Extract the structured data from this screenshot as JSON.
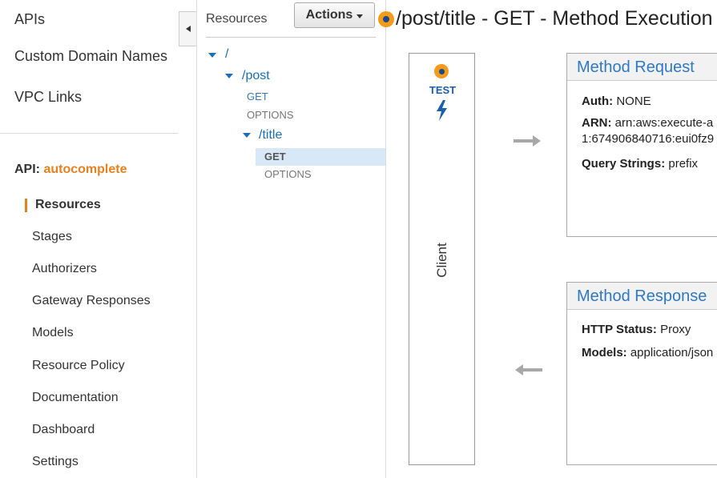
{
  "nav": {
    "top_links": [
      "APIs",
      "Custom Domain Names",
      "VPC Links"
    ],
    "api_prefix": "API:",
    "api_name": "autocomplete",
    "items": [
      {
        "label": "Resources",
        "active": true
      },
      {
        "label": "Stages"
      },
      {
        "label": "Authorizers"
      },
      {
        "label": "Gateway Responses"
      },
      {
        "label": "Models"
      },
      {
        "label": "Resource Policy"
      },
      {
        "label": "Documentation"
      },
      {
        "label": "Dashboard"
      },
      {
        "label": "Settings"
      }
    ]
  },
  "tree": {
    "title": "Resources",
    "actions_label": "Actions",
    "root": "/",
    "post": "/post",
    "post_methods": [
      "GET",
      "OPTIONS"
    ],
    "title_res": "/title",
    "title_methods": [
      "GET",
      "OPTIONS"
    ],
    "selected": "GET"
  },
  "main": {
    "title": "/post/title - GET - Method Execution",
    "client": {
      "test_label": "TEST",
      "label": "Client"
    },
    "method_request": {
      "heading": "Method Request",
      "auth_key": "Auth:",
      "auth_val": "NONE",
      "arn_key": "ARN:",
      "arn_val": "arn:aws:execute-a",
      "arn_val2": "1:674906840716:eui0fz9",
      "qs_key": "Query Strings:",
      "qs_val": "prefix"
    },
    "method_response": {
      "heading": "Method Response",
      "status_key": "HTTP Status:",
      "status_val": "Proxy",
      "models_key": "Models:",
      "models_val": "application/json"
    }
  },
  "colors": {
    "accent_orange": "#e7801f",
    "link_blue": "#1a6fb5",
    "selected_bg": "#d8e8f7"
  },
  "icons": [
    "collapse-left-icon",
    "caret-down-icon",
    "status-dot-icon",
    "lightning-bolt-icon",
    "arrow-right-icon",
    "arrow-left-icon"
  ]
}
